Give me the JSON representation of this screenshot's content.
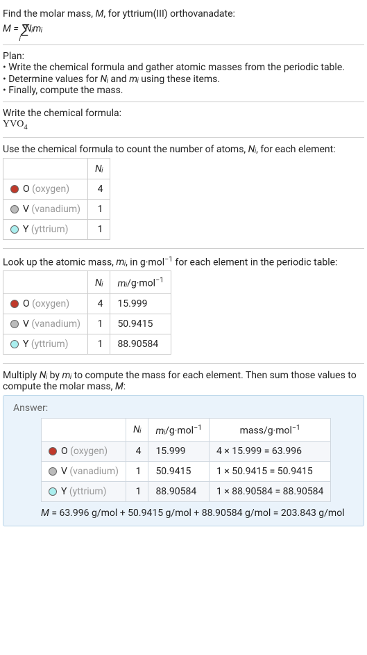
{
  "intro": {
    "line1_before": "Find the molar mass, ",
    "line1_var": "M",
    "line1_after": ", for yttrium(III) orthovanadate:",
    "eq_lhs": "M",
    "eq_eq": " = ",
    "eq_sigma": "∑",
    "eq_sigma_sub": "i",
    "eq_rhs": "Nᵢmᵢ"
  },
  "plan": {
    "title": "Plan:",
    "bullet1": "• Write the chemical formula and gather atomic masses from the periodic table.",
    "bullet2_a": "• Determine values for ",
    "bullet2_var1": "Nᵢ",
    "bullet2_b": " and ",
    "bullet2_var2": "mᵢ",
    "bullet2_c": " using these items.",
    "bullet3": "• Finally, compute the mass."
  },
  "formula_section": {
    "title": "Write the chemical formula:",
    "formula_base": "YVO",
    "formula_sub": "4"
  },
  "count_section": {
    "text_a": "Use the chemical formula to count the number of atoms, ",
    "text_var": "Nᵢ",
    "text_b": ", for each element:",
    "header_Ni": "Nᵢ",
    "rows": [
      {
        "color": "dot-red",
        "el": "O",
        "el_gray": " (oxygen)",
        "n": "4"
      },
      {
        "color": "dot-gray",
        "el": "V",
        "el_gray": " (vanadium)",
        "n": "1"
      },
      {
        "color": "dot-cyan",
        "el": "Y",
        "el_gray": " (yttrium)",
        "n": "1"
      }
    ]
  },
  "mass_section": {
    "text_a": "Look up the atomic mass, ",
    "text_var": "mᵢ",
    "text_b": ", in g·mol",
    "text_sup": "−1",
    "text_c": " for each element in the periodic table:",
    "header_Ni": "Nᵢ",
    "header_mi_a": "mᵢ",
    "header_mi_b": "/g·mol",
    "header_mi_sup": "−1",
    "rows": [
      {
        "color": "dot-red",
        "el": "O",
        "el_gray": " (oxygen)",
        "n": "4",
        "m": "15.999"
      },
      {
        "color": "dot-gray",
        "el": "V",
        "el_gray": " (vanadium)",
        "n": "1",
        "m": "50.9415"
      },
      {
        "color": "dot-cyan",
        "el": "Y",
        "el_gray": " (yttrium)",
        "n": "1",
        "m": "88.90584"
      }
    ]
  },
  "multiply_section": {
    "text_a": "Multiply ",
    "var1": "Nᵢ",
    "text_b": " by ",
    "var2": "mᵢ",
    "text_c": " to compute the mass for each element. Then sum those values to compute the molar mass, ",
    "var3": "M",
    "text_d": ":"
  },
  "answer": {
    "label": "Answer:",
    "header_Ni": "Nᵢ",
    "header_mi_a": "mᵢ",
    "header_mi_b": "/g·mol",
    "header_mi_sup": "−1",
    "header_mass_a": "mass/g·mol",
    "header_mass_sup": "−1",
    "rows": [
      {
        "color": "dot-red",
        "el": "O",
        "el_gray": " (oxygen)",
        "n": "4",
        "m": "15.999",
        "calc": "4 × 15.999 = 63.996"
      },
      {
        "color": "dot-gray",
        "el": "V",
        "el_gray": " (vanadium)",
        "n": "1",
        "m": "50.9415",
        "calc": "1 × 50.9415 = 50.9415"
      },
      {
        "color": "dot-cyan",
        "el": "Y",
        "el_gray": " (yttrium)",
        "n": "1",
        "m": "88.90584",
        "calc": "1 × 88.90584 = 88.90584"
      }
    ],
    "final_var": "M",
    "final_eq": " = 63.996 g/mol + 50.9415 g/mol + 88.90584 g/mol = 203.843 g/mol"
  },
  "chart_data": {
    "type": "table",
    "title": "Molar mass of yttrium(III) orthovanadate (YVO4)",
    "columns": [
      "element",
      "N_i",
      "m_i (g/mol)",
      "mass (g/mol)"
    ],
    "rows": [
      [
        "O (oxygen)",
        4,
        15.999,
        63.996
      ],
      [
        "V (vanadium)",
        1,
        50.9415,
        50.9415
      ],
      [
        "Y (yttrium)",
        1,
        88.90584,
        88.90584
      ]
    ],
    "total_molar_mass_g_per_mol": 203.843
  }
}
